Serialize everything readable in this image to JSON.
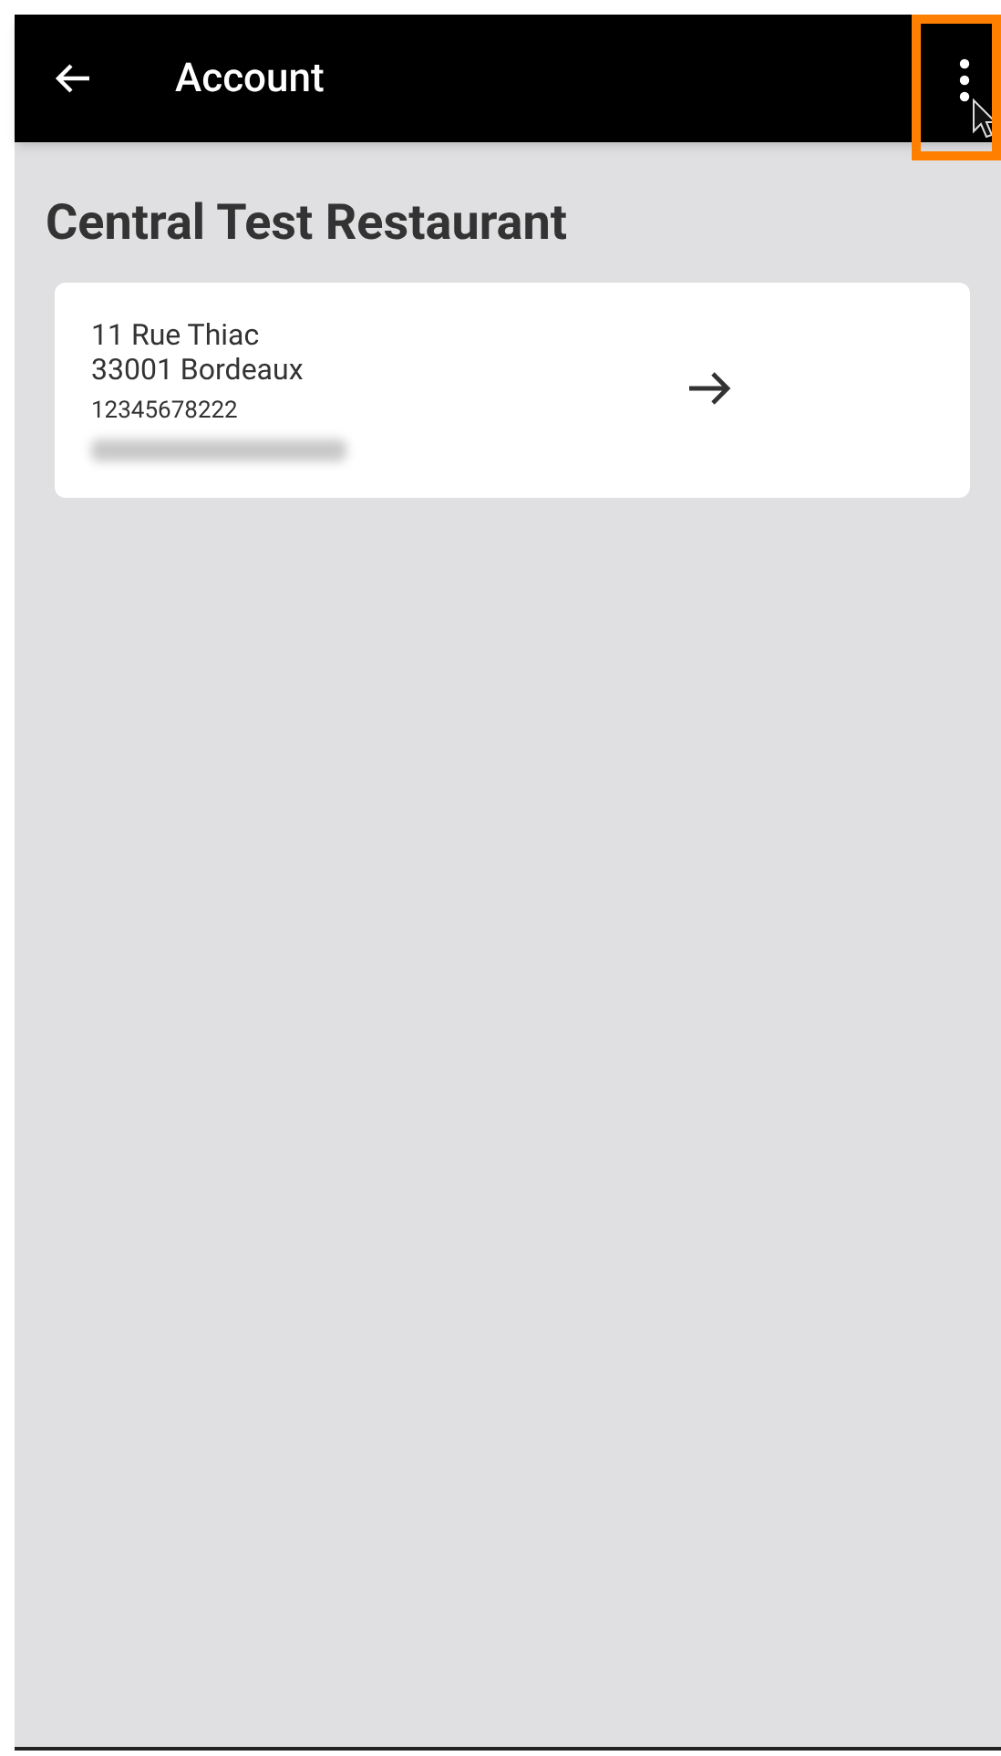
{
  "header": {
    "title": "Account",
    "menu_highlighted": true
  },
  "account": {
    "name": "Central Test Restaurant",
    "address_lines": [
      "11 Rue Thiac",
      "33001 Bordeaux"
    ],
    "phone": "12345678222"
  }
}
